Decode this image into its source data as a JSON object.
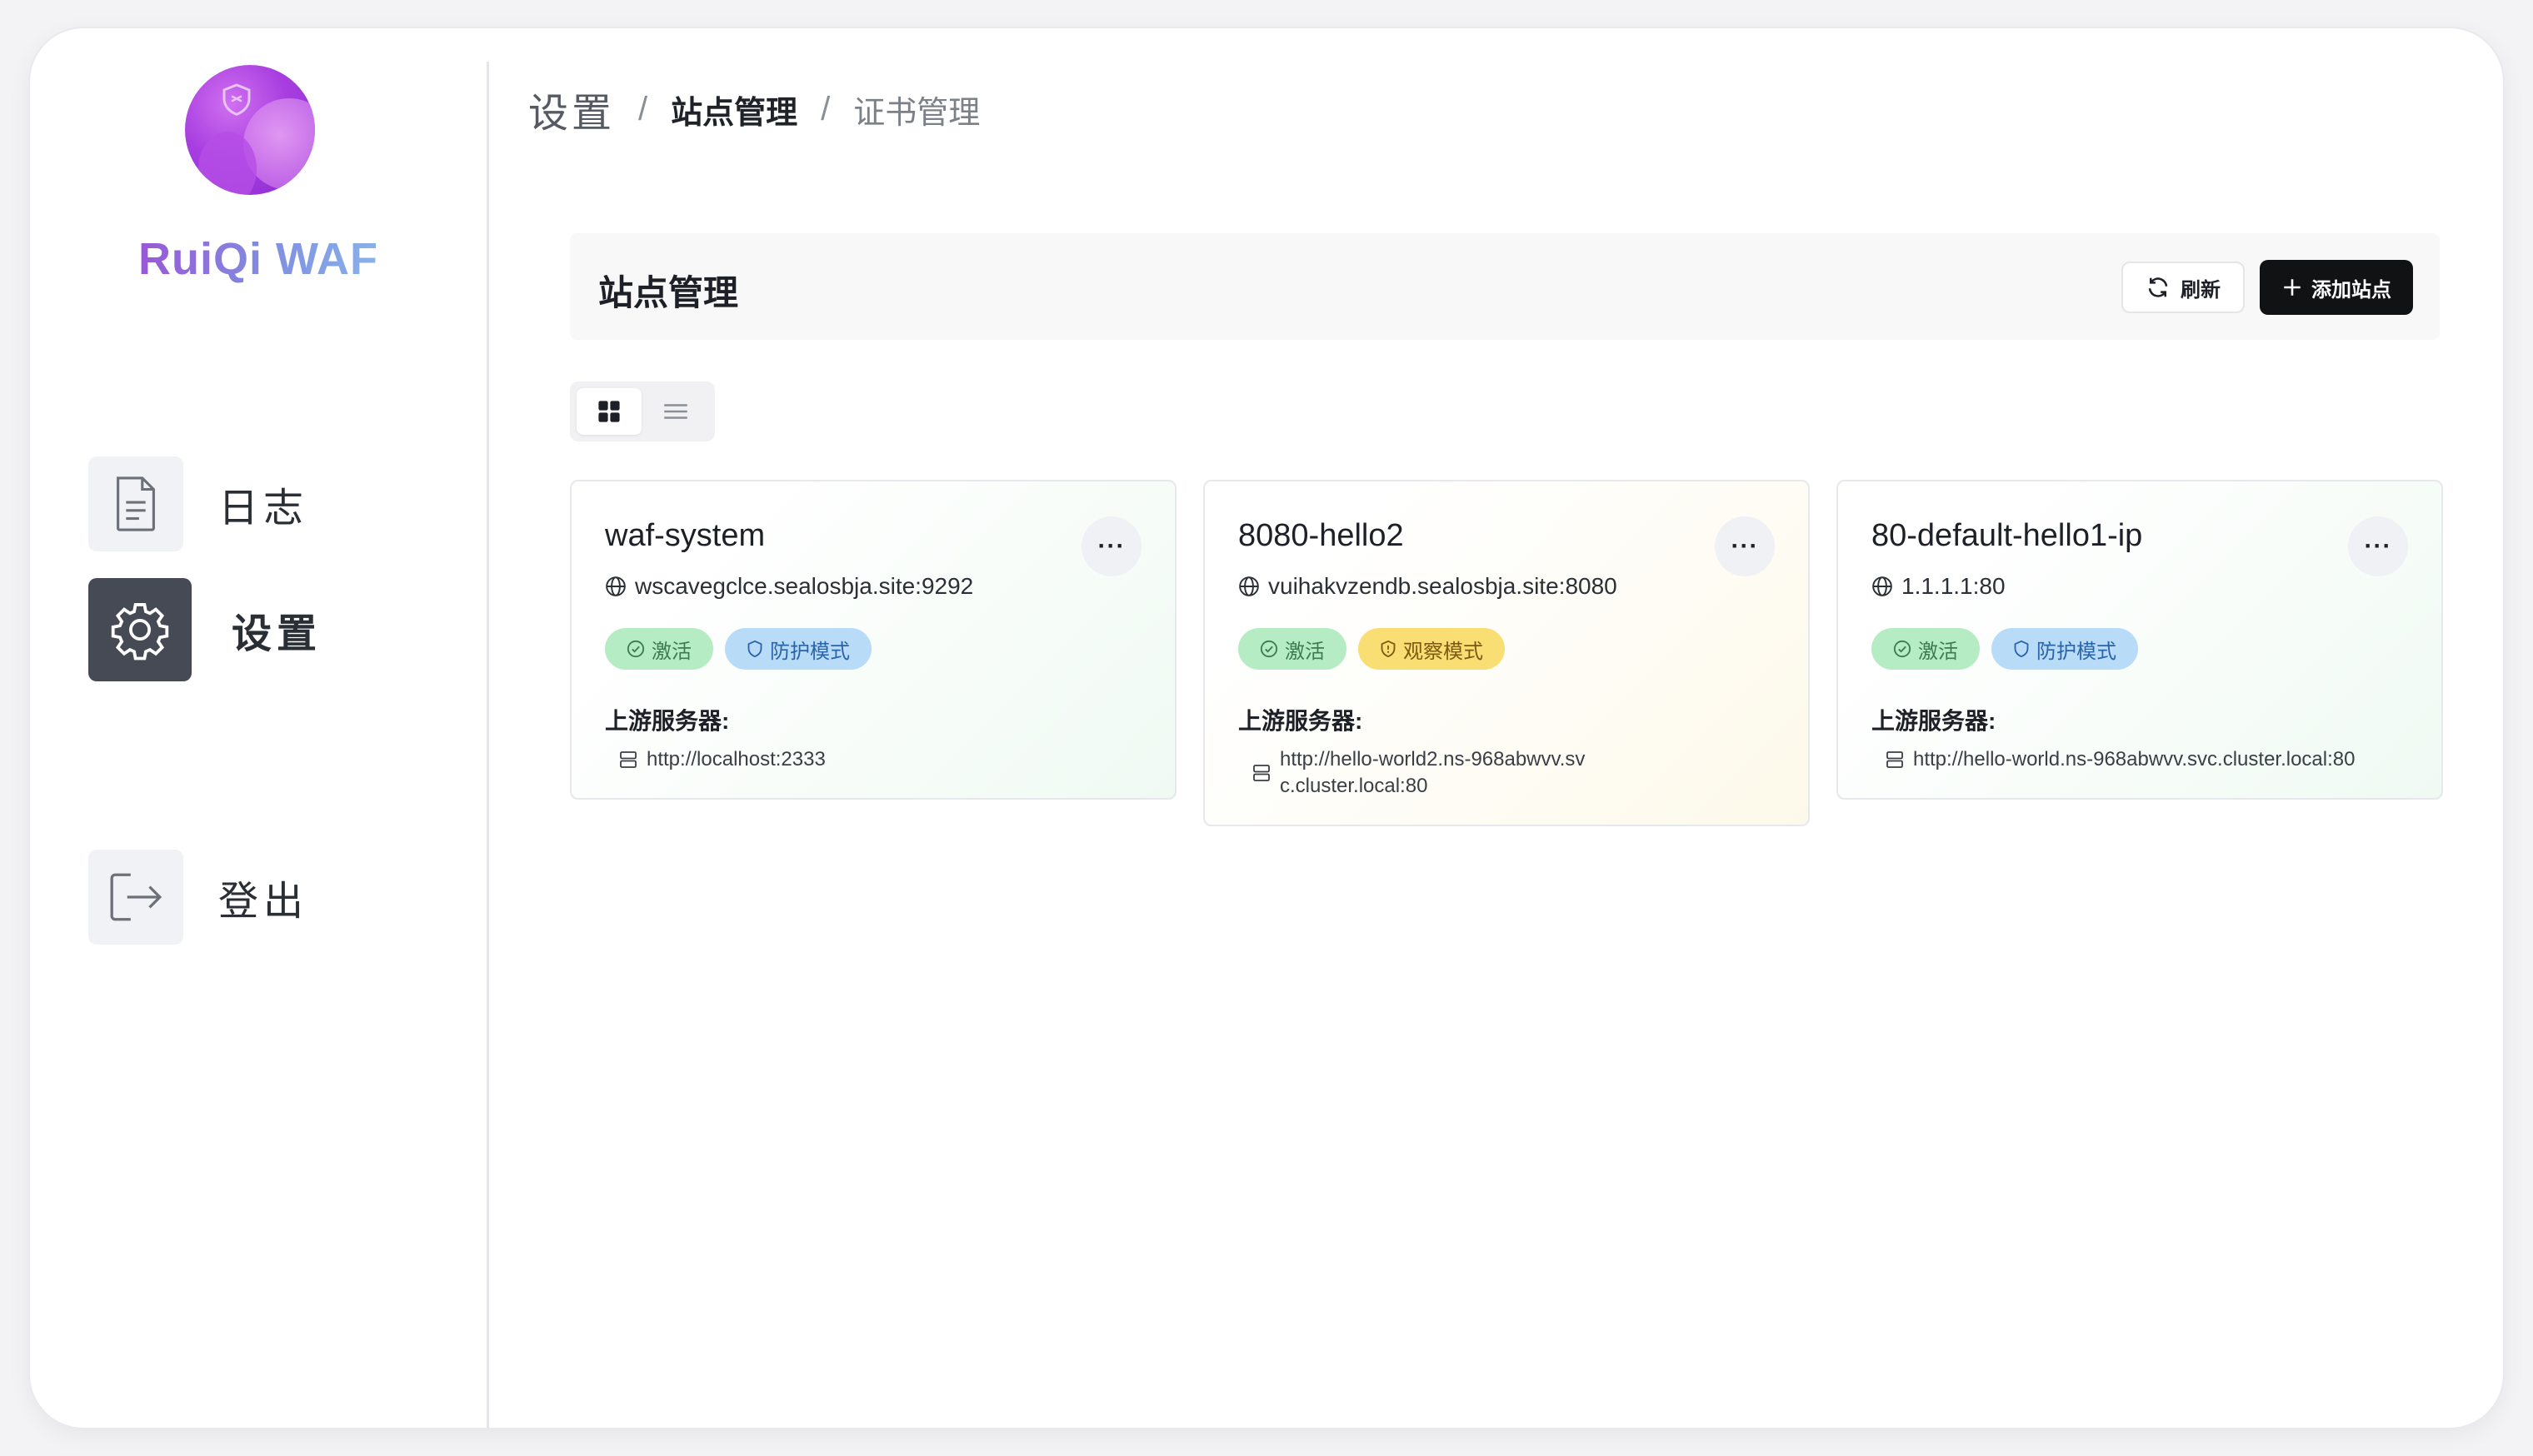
{
  "app": {
    "brand": "RuiQi WAF",
    "logo_icon": "shield-icon"
  },
  "sidebar": {
    "items": [
      {
        "label": "日志",
        "icon": "document-icon",
        "active": false
      },
      {
        "label": "设置",
        "icon": "gear-icon",
        "active": true
      },
      {
        "label": "登出",
        "icon": "logout-icon",
        "active": false
      }
    ]
  },
  "breadcrumb": [
    "设置",
    "站点管理",
    "证书管理"
  ],
  "header": {
    "title": "站点管理",
    "refresh_label": "刷新",
    "add_label": "添加站点"
  },
  "view_toggle": {
    "selected": "grid",
    "options": [
      "grid",
      "list"
    ]
  },
  "sites": [
    {
      "name": "waf-system",
      "host": "wscavegclce.sealosbja.site:9292",
      "status": "激活",
      "mode": "防护模式",
      "mode_color": "blue",
      "upstream_label": "上游服务器:",
      "upstream": "http://localhost:2333"
    },
    {
      "name": "8080-hello2",
      "host": "vuihakvzendb.sealosbja.site:8080",
      "status": "激活",
      "mode": "观察模式",
      "mode_color": "yellow",
      "upstream_label": "上游服务器:",
      "upstream": "http://hello-world2.ns-968abwvv.svc.cluster.local:80"
    },
    {
      "name": "80-default-hello1-ip",
      "host": "1.1.1.1:80",
      "status": "激活",
      "mode": "防护模式",
      "mode_color": "blue",
      "upstream_label": "上游服务器:",
      "upstream": "http://hello-world.ns-968abwvv.svc.cluster.local:80"
    }
  ],
  "colors": {
    "active_nav_bg": "#454a54",
    "primary_button": "#111214",
    "badge_green": "#b6ecc4",
    "badge_blue": "#b8dcf8",
    "badge_yellow": "#f8de73"
  }
}
